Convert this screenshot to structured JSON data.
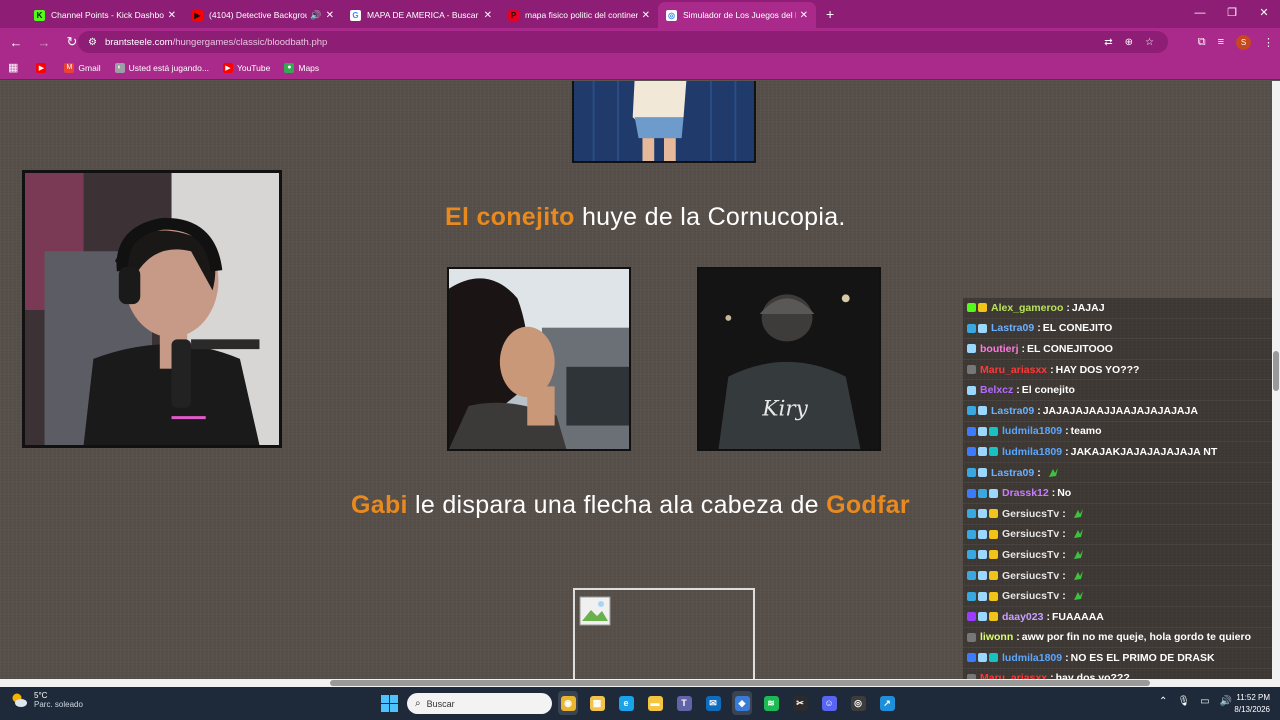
{
  "browser": {
    "tabs": [
      {
        "title": "Channel Points - Kick Dashbo...",
        "icon": "kick-icon",
        "color": "#53fc18",
        "glyph": "K"
      },
      {
        "title": "(4104) Detective Backgroun...",
        "icon": "youtube-icon",
        "color": "#ff0000",
        "glyph": "▶"
      },
      {
        "title": "MAPA DE AMERICA - Buscar co...",
        "icon": "google-icon",
        "color": "#ffffff",
        "glyph": "G"
      },
      {
        "title": "mapa fisico politic del continen...",
        "icon": "pinterest-icon",
        "color": "#e60023",
        "glyph": "P"
      },
      {
        "title": "Simulador de Los Juegos del H...",
        "icon": "site-icon",
        "color": "#ffffff",
        "glyph": "◎"
      }
    ],
    "url_host": "brantsteele.com",
    "url_path": "/hungergames/classic/bloodbath.php",
    "profile_initial": "S",
    "bookmarks": [
      {
        "label": "",
        "icon": "youtube-icon"
      },
      {
        "label": "Gmail",
        "icon": "gmail-icon"
      },
      {
        "label": "Usted está jugando...",
        "icon": "game-icon"
      },
      {
        "label": "YouTube",
        "icon": "youtube-icon"
      },
      {
        "label": "Maps",
        "icon": "maps-icon"
      }
    ]
  },
  "game": {
    "event1": {
      "name1": "El conejito",
      "action": " huye de la Cornucopia."
    },
    "event2": {
      "name1": "Gabi",
      "action1": " le dispara una flecha ala cabeza de ",
      "name2": "Godfar"
    }
  },
  "chat": [
    {
      "user": "Alex_gameroo",
      "color": "#b7e35a",
      "text": "JAJAJ",
      "badges": [
        "#53fc18",
        "#f0c419"
      ]
    },
    {
      "user": "Lastra09",
      "color": "#6ab0ff",
      "text": "EL CONEJITO",
      "badges": [
        "#3aa8e0",
        "#9ad8ff"
      ]
    },
    {
      "user": "boutierj",
      "color": "#ff7adf",
      "text": "EL CONEJITOOO",
      "badges": [
        "#9ad8ff"
      ]
    },
    {
      "user": "Maru_ariasxx",
      "color": "#ff3838",
      "text": "HAY DOS YO???",
      "badges": [
        "#777777"
      ]
    },
    {
      "user": "Belxcz",
      "color": "#b56bff",
      "text": "El conejito",
      "badges": [
        "#9ad8ff"
      ]
    },
    {
      "user": "Lastra09",
      "color": "#6ab0ff",
      "text": "JAJAJAJAAJJAAJAJAJAJAJA",
      "badges": [
        "#3aa8e0",
        "#9ad8ff"
      ]
    },
    {
      "user": "ludmila1809",
      "color": "#5aa7ff",
      "text": "teamo",
      "badges": [
        "#3a7bff",
        "#9ad8ff",
        "#19c2c2"
      ]
    },
    {
      "user": "ludmila1809",
      "color": "#5aa7ff",
      "text": "JAKAJAKJAJAJAJAJAJA NT",
      "badges": [
        "#3a7bff",
        "#9ad8ff",
        "#19c2c2"
      ]
    },
    {
      "user": "Lastra09",
      "color": "#6ab0ff",
      "text": "",
      "emote": true,
      "badges": [
        "#3aa8e0",
        "#9ad8ff"
      ]
    },
    {
      "user": "Drassk12",
      "color": "#c77dff",
      "text": "No",
      "badges": [
        "#3a7bff",
        "#3aa8e0",
        "#9ad8ff"
      ]
    },
    {
      "user": "GersiucsTv",
      "color": "#e6e6e6",
      "text": "",
      "emote": true,
      "badges": [
        "#3aa8e0",
        "#9ad8ff",
        "#f0c419"
      ]
    },
    {
      "user": "GersiucsTv",
      "color": "#e6e6e6",
      "text": "",
      "emote": true,
      "badges": [
        "#3aa8e0",
        "#9ad8ff",
        "#f0c419"
      ]
    },
    {
      "user": "GersiucsTv",
      "color": "#e6e6e6",
      "text": "",
      "emote": true,
      "badges": [
        "#3aa8e0",
        "#9ad8ff",
        "#f0c419"
      ]
    },
    {
      "user": "GersiucsTv",
      "color": "#e6e6e6",
      "text": "",
      "emote": true,
      "badges": [
        "#3aa8e0",
        "#9ad8ff",
        "#f0c419"
      ]
    },
    {
      "user": "GersiucsTv",
      "color": "#e6e6e6",
      "text": "",
      "emote": true,
      "badges": [
        "#3aa8e0",
        "#9ad8ff",
        "#f0c419"
      ]
    },
    {
      "user": "daay023",
      "color": "#c7a1ff",
      "text": "FUAAAAA",
      "badges": [
        "#9b3cff",
        "#9ad8ff",
        "#f0c419"
      ]
    },
    {
      "user": "liwonn",
      "color": "#d9ff6a",
      "text": "aww por fin no me queje, hola gordo te quiero",
      "badges": [
        "#777777"
      ]
    },
    {
      "user": "ludmila1809",
      "color": "#5aa7ff",
      "text": "NO ES EL PRIMO DE DRASK",
      "badges": [
        "#3a7bff",
        "#9ad8ff",
        "#19c2c2"
      ]
    },
    {
      "user": "Maru_ariasxx",
      "color": "#ff3838",
      "text": "hay dos yo???",
      "badges": [
        "#777777"
      ]
    }
  ],
  "taskbar": {
    "temp": "5°C",
    "weather": "Parc. soleado",
    "search_placeholder": "Buscar",
    "time": "11:52 PM",
    "date": "8/13/2026",
    "apps": [
      {
        "icon": "chrome-icon",
        "color": "#e8b531",
        "glyph": "◉",
        "active": true
      },
      {
        "icon": "store-icon",
        "color": "#f2c14e",
        "glyph": "▦"
      },
      {
        "icon": "edge-icon",
        "color": "#1aa3e8",
        "glyph": "e"
      },
      {
        "icon": "folder-icon",
        "color": "#f5c542",
        "glyph": "▬"
      },
      {
        "icon": "teams-icon",
        "color": "#6264a7",
        "glyph": "T"
      },
      {
        "icon": "mail-icon",
        "color": "#0f6cbd",
        "glyph": "✉"
      },
      {
        "icon": "shield-icon",
        "color": "#3a7bd5",
        "glyph": "◆",
        "active": true
      },
      {
        "icon": "spotify-icon",
        "color": "#1db954",
        "glyph": "≋"
      },
      {
        "icon": "capcut-icon",
        "color": "#2b2b2b",
        "glyph": "✂"
      },
      {
        "icon": "discord-icon",
        "color": "#5865f2",
        "glyph": "☺"
      },
      {
        "icon": "obs-icon",
        "color": "#3c3c3c",
        "glyph": "◎"
      },
      {
        "icon": "app-icon",
        "color": "#1e8fd8",
        "glyph": "↗"
      }
    ]
  }
}
